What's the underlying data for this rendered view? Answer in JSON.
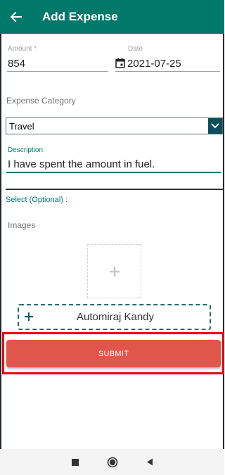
{
  "header": {
    "title": "Add Expense"
  },
  "form": {
    "amount": {
      "label": "Amount *",
      "value": "854"
    },
    "date": {
      "label": "Date",
      "value": "2021-07-25"
    },
    "category": {
      "label": "Expense Category",
      "value": "Travel"
    },
    "description": {
      "label": "Description",
      "value": "I have spent the amount in fuel."
    },
    "optional_label": "Select (Optional) :",
    "images_label": "Images",
    "assignee": {
      "name": "Automiraj Kandy"
    },
    "submit_label": "SUBMIT"
  },
  "colors": {
    "primary": "#00796b",
    "submit": "#e0564b",
    "highlight": "#e8000b"
  },
  "icons": {
    "back": "arrow-left-icon",
    "calendar": "calendar-icon",
    "dropdown": "chevron-down-icon",
    "add_image": "plus-icon",
    "add_assignee": "plus-icon",
    "nav_recent": "square-icon",
    "nav_home": "circle-icon",
    "nav_back": "triangle-left-icon"
  }
}
